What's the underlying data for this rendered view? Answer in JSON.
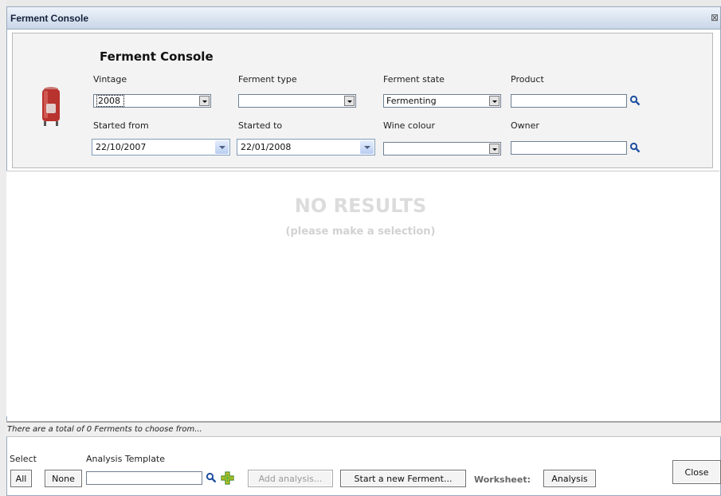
{
  "window": {
    "title": "Ferment Console",
    "close_glyph": "⊠"
  },
  "search_panel": {
    "heading": "Ferment Console",
    "icon": "wine-tank-icon",
    "fields": {
      "vintage": {
        "label": "Vintage",
        "value": "2008"
      },
      "ferment_type": {
        "label": "Ferment type",
        "value": ""
      },
      "ferment_state": {
        "label": "Ferment state",
        "value": "Fermenting"
      },
      "product": {
        "label": "Product",
        "value": ""
      },
      "started_from": {
        "label": "Started from",
        "value": "22/10/2007"
      },
      "started_to": {
        "label": "Started to",
        "value": "22/01/2008"
      },
      "wine_colour": {
        "label": "Wine colour",
        "value": ""
      },
      "owner": {
        "label": "Owner",
        "value": ""
      }
    }
  },
  "results": {
    "empty_title": "NO RESULTS",
    "empty_subtitle": "(please make a selection)"
  },
  "status": {
    "text": "There are a total of 0 Ferments to choose from..."
  },
  "footer": {
    "select_label": "Select",
    "all_button": "All",
    "none_button": "None",
    "analysis_template_label": "Analysis Template",
    "analysis_template_value": "",
    "add_analysis_button": "Add analysis...",
    "start_ferment_button": "Start a new Ferment...",
    "worksheet_label": "Worksheet:",
    "analysis_button": "Analysis",
    "close_button": "Close"
  },
  "colors": {
    "titlebar_top": "#eef3fa",
    "titlebar_bottom": "#c9d6e8",
    "panel_bg": "#f3f3f3",
    "search_icon": "#1e4fa0",
    "tank_red": "#b8322e"
  }
}
